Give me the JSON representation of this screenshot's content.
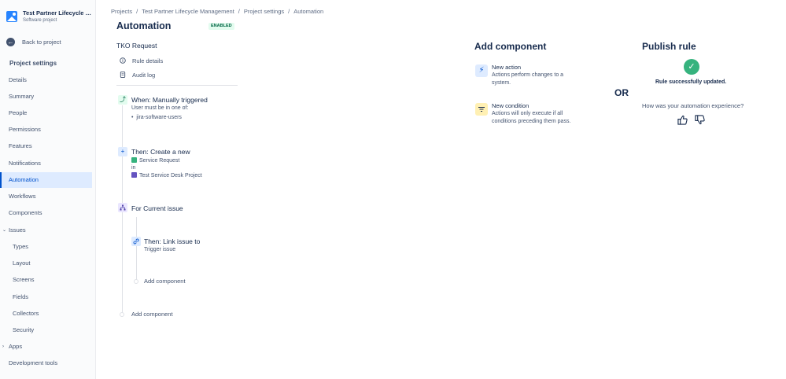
{
  "sidebar": {
    "project_name": "Test Partner Lifecycle Management",
    "project_type": "Software project",
    "back_label": "Back to project",
    "section_title": "Project settings",
    "items": [
      {
        "label": "Details"
      },
      {
        "label": "Summary"
      },
      {
        "label": "People"
      },
      {
        "label": "Permissions"
      },
      {
        "label": "Features"
      },
      {
        "label": "Notifications"
      },
      {
        "label": "Automation",
        "active": true
      },
      {
        "label": "Workflows"
      },
      {
        "label": "Components"
      },
      {
        "label": "Issues",
        "expanded": true
      },
      {
        "label": "Types"
      },
      {
        "label": "Layout"
      },
      {
        "label": "Screens"
      },
      {
        "label": "Fields"
      },
      {
        "label": "Collectors"
      },
      {
        "label": "Security"
      },
      {
        "label": "Apps",
        "expanded": false
      },
      {
        "label": "Development tools"
      }
    ]
  },
  "breadcrumbs": [
    "Projects",
    "Test Partner Lifecycle Management",
    "Project settings",
    "Automation"
  ],
  "header": {
    "title": "Automation",
    "status": "ENABLED"
  },
  "rule": {
    "name": "TKO Request",
    "links": [
      {
        "label": "Rule details",
        "icon": "info-icon"
      },
      {
        "label": "Audit log",
        "icon": "document-icon"
      }
    ]
  },
  "flow": {
    "trigger": {
      "title": "When: Manually triggered",
      "condition_text": "User must be in one of:",
      "groups": [
        "jira-software-users"
      ]
    },
    "create": {
      "title": "Then: Create a new",
      "issue_type": "Service Request",
      "in_label": "in",
      "project": "Test Service Desk Project"
    },
    "branch": {
      "title": "For Current issue"
    },
    "link": {
      "title": "Then: Link issue to",
      "target": "Trigger issue"
    },
    "inner_add": "Add component",
    "outer_add": "Add component"
  },
  "add_component": {
    "title": "Add component",
    "action": {
      "title": "New action",
      "desc1": "Actions perform changes to a",
      "desc2": "system."
    },
    "condition": {
      "title": "New condition",
      "desc1": "Actions will only execute if all",
      "desc2": "conditions preceding them pass."
    }
  },
  "or_label": "OR",
  "publish": {
    "title": "Publish rule",
    "success": "Rule successfully updated.",
    "question": "How was your automation experience?"
  },
  "colors": {
    "accent": "#0052cc",
    "success": "#36b37e",
    "condition_bg": "#fff0b3",
    "action_bg": "#deebff"
  }
}
